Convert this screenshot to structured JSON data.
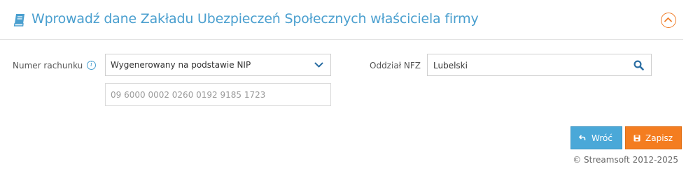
{
  "header": {
    "title": "Wprowadź dane Zakładu Ubezpieczeń Społecznych właściciela firmy",
    "icon": "book-icon",
    "collapse_icon": "chevron-up-icon"
  },
  "form": {
    "account_number_label": "Numer rachunku",
    "account_select_value": "Wygenerowany na podstawie NIP",
    "account_number_value": "09 6000 0002 0260 0192 9185 1723",
    "nfz_label": "Oddział NFZ",
    "nfz_value": "Lubelski"
  },
  "buttons": {
    "back_label": "Wróć",
    "save_label": "Zapisz"
  },
  "footer": {
    "copyright": "© Streamsoft 2012-2025"
  },
  "colors": {
    "accent_blue": "#4a9fcf",
    "accent_orange": "#f47d20"
  }
}
